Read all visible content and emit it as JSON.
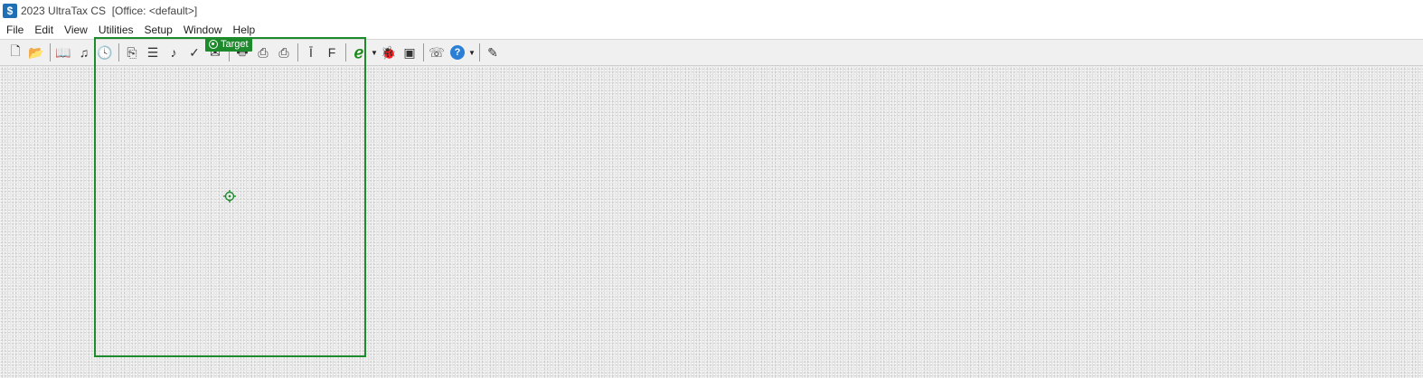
{
  "window": {
    "title": "2023 UltraTax CS  [Office: <default>]",
    "app_icon_glyph": "$"
  },
  "menu": [
    {
      "label": "File"
    },
    {
      "label": "Edit"
    },
    {
      "label": "View"
    },
    {
      "label": "Utilities"
    },
    {
      "label": "Setup"
    },
    {
      "label": "Window"
    },
    {
      "label": "Help"
    }
  ],
  "toolbar": {
    "buttons": [
      {
        "name": "new-icon",
        "glyph": "🗋"
      },
      {
        "name": "open-folder-icon",
        "glyph": "📂"
      },
      {
        "name": "sep"
      },
      {
        "name": "book-icon",
        "glyph": "📖"
      },
      {
        "name": "music-note-icon",
        "glyph": "♫"
      },
      {
        "name": "clock-icon",
        "glyph": "🕓"
      },
      {
        "name": "sep"
      },
      {
        "name": "copy-icon",
        "glyph": "⎘"
      },
      {
        "name": "list-icon",
        "glyph": "☰"
      },
      {
        "name": "note-icon",
        "glyph": "♪"
      },
      {
        "name": "check-icon",
        "glyph": "✓"
      },
      {
        "name": "envelope-icon",
        "glyph": "✉"
      },
      {
        "name": "sep"
      },
      {
        "name": "printer-icon",
        "glyph": "🖶"
      },
      {
        "name": "print-preview-icon",
        "glyph": "⎙"
      },
      {
        "name": "print-batch-icon",
        "glyph": "⎙"
      },
      {
        "name": "sep"
      },
      {
        "name": "text-indent-icon",
        "glyph": "Ī"
      },
      {
        "name": "format-icon",
        "glyph": "F"
      },
      {
        "name": "sep"
      },
      {
        "name": "efile-icon",
        "glyph": "ℯ"
      },
      {
        "name": "efile-dropdown",
        "glyph": "▼"
      },
      {
        "name": "bug-icon",
        "glyph": "🐞"
      },
      {
        "name": "image-icon",
        "glyph": "▣"
      },
      {
        "name": "sep"
      },
      {
        "name": "support-icon",
        "glyph": "☏"
      },
      {
        "name": "help-icon",
        "glyph": "?"
      },
      {
        "name": "help-dropdown",
        "glyph": "▼"
      },
      {
        "name": "sep"
      },
      {
        "name": "whats-this-icon",
        "glyph": "✎"
      }
    ]
  },
  "overlay": {
    "target_label": "Target",
    "accent_color": "#1d8a2c"
  }
}
